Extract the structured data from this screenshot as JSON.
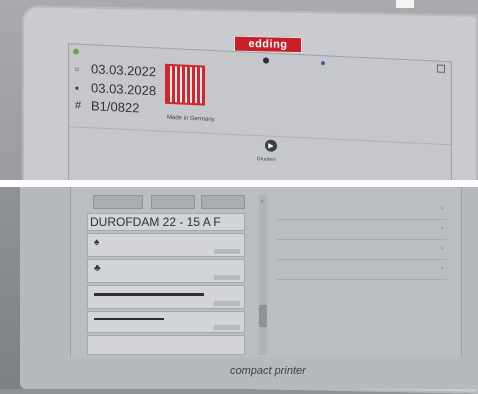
{
  "bezel": {
    "logo": "edding",
    "brand": "compact printer"
  },
  "label_preview": {
    "line1": "03.03.2022",
    "line2": "03.03.2028",
    "line3": "B1/0822",
    "made_in": "Made in Germany"
  },
  "play": {
    "label": "Drucken"
  },
  "queue": {
    "first_row_text": "DUROFDAM   22 - 15 A   F"
  },
  "colors": {
    "accent": "#c8202a",
    "code": "#d4252c"
  },
  "icons": [
    "calendar-icon",
    "drop-icon",
    "hash-icon",
    "play-icon",
    "fire-icon",
    "leaf-icon",
    "chevron-right-icon"
  ]
}
